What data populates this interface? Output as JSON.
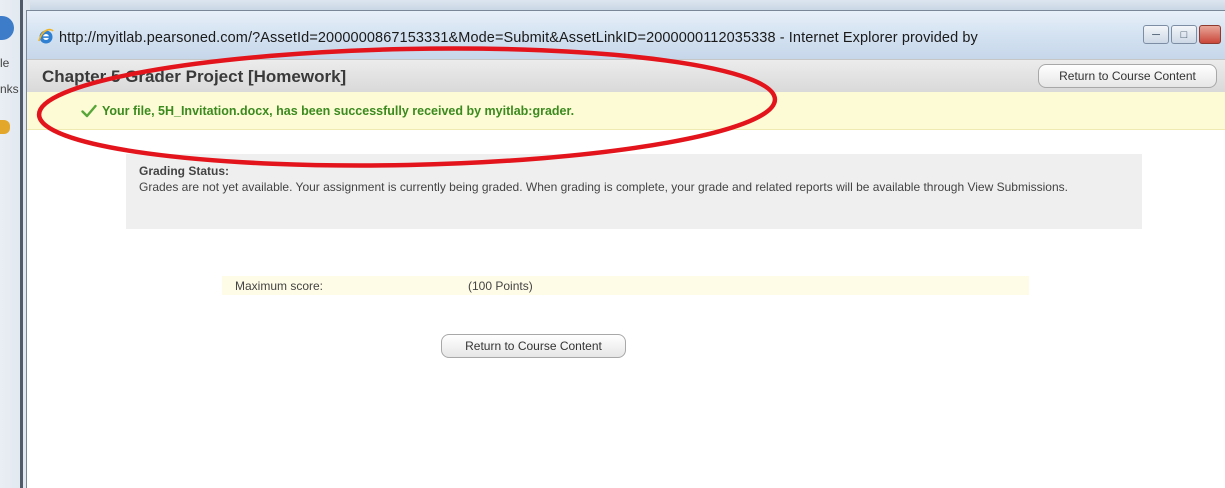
{
  "window": {
    "title_bar_text": "http://myitlab.pearsoned.com/?AssetId=2000000867153331&Mode=Submit&AssetLinkID=2000000112035338 - Internet Explorer provided by"
  },
  "background": {
    "fragments": [
      "le",
      "nks"
    ]
  },
  "header": {
    "title": "Chapter 5 Grader Project [Homework]",
    "return_button": "Return to Course Content"
  },
  "banner": {
    "message": "Your file, 5H_Invitation.docx, has been successfully received by myitlab:grader."
  },
  "grading_status": {
    "heading": "Grading Status:",
    "text": "Grades are not yet available. Your assignment is currently being graded. When grading is complete, your grade and related reports will be available through View Submissions."
  },
  "score": {
    "label": "Maximum score:",
    "value": "(100 Points)"
  },
  "footer": {
    "return_button": "Return to Course Content"
  },
  "colors": {
    "banner_background": "#fdfbd6",
    "success_text": "#3b8a1e",
    "annotation_ellipse": "#e3141b"
  },
  "icons": {
    "window_icon": "internet-explorer-icon",
    "success_icon": "checkmark-icon",
    "minimize": "minimize-icon",
    "maximize": "maximize-icon",
    "close": "close-icon"
  }
}
